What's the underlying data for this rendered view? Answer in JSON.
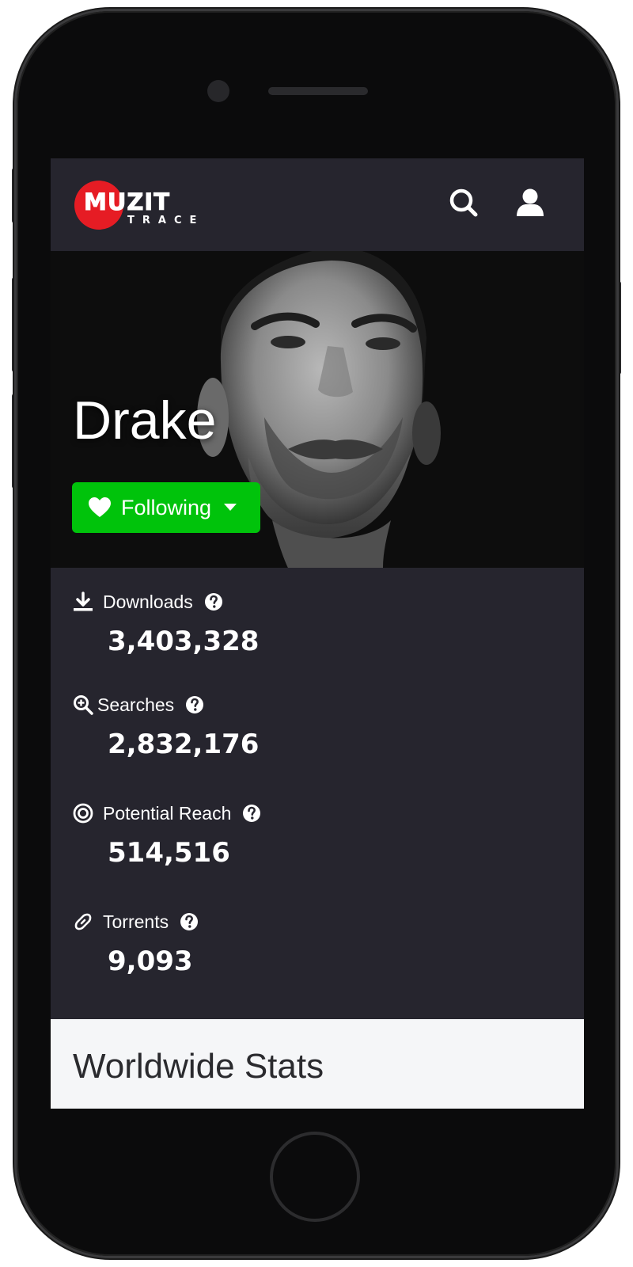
{
  "app": {
    "logo_text": "MUZIT",
    "logo_subtext": "TRACE",
    "brand_color": "#e61c24"
  },
  "navbar": {
    "search_icon": "search-icon",
    "user_icon": "user-icon"
  },
  "artist": {
    "name": "Drake",
    "follow_label": "Following",
    "follow_color": "#00c30b"
  },
  "stats": [
    {
      "icon": "download-icon",
      "label": "Downloads",
      "value": "3,403,328"
    },
    {
      "icon": "search-zoom-icon",
      "label": "Searches",
      "value": "2,832,176"
    },
    {
      "icon": "target-icon",
      "label": "Potential Reach",
      "value": "514,516"
    },
    {
      "icon": "link-icon",
      "label": "Torrents",
      "value": "9,093"
    }
  ],
  "section": {
    "title": "Worldwide Stats"
  }
}
